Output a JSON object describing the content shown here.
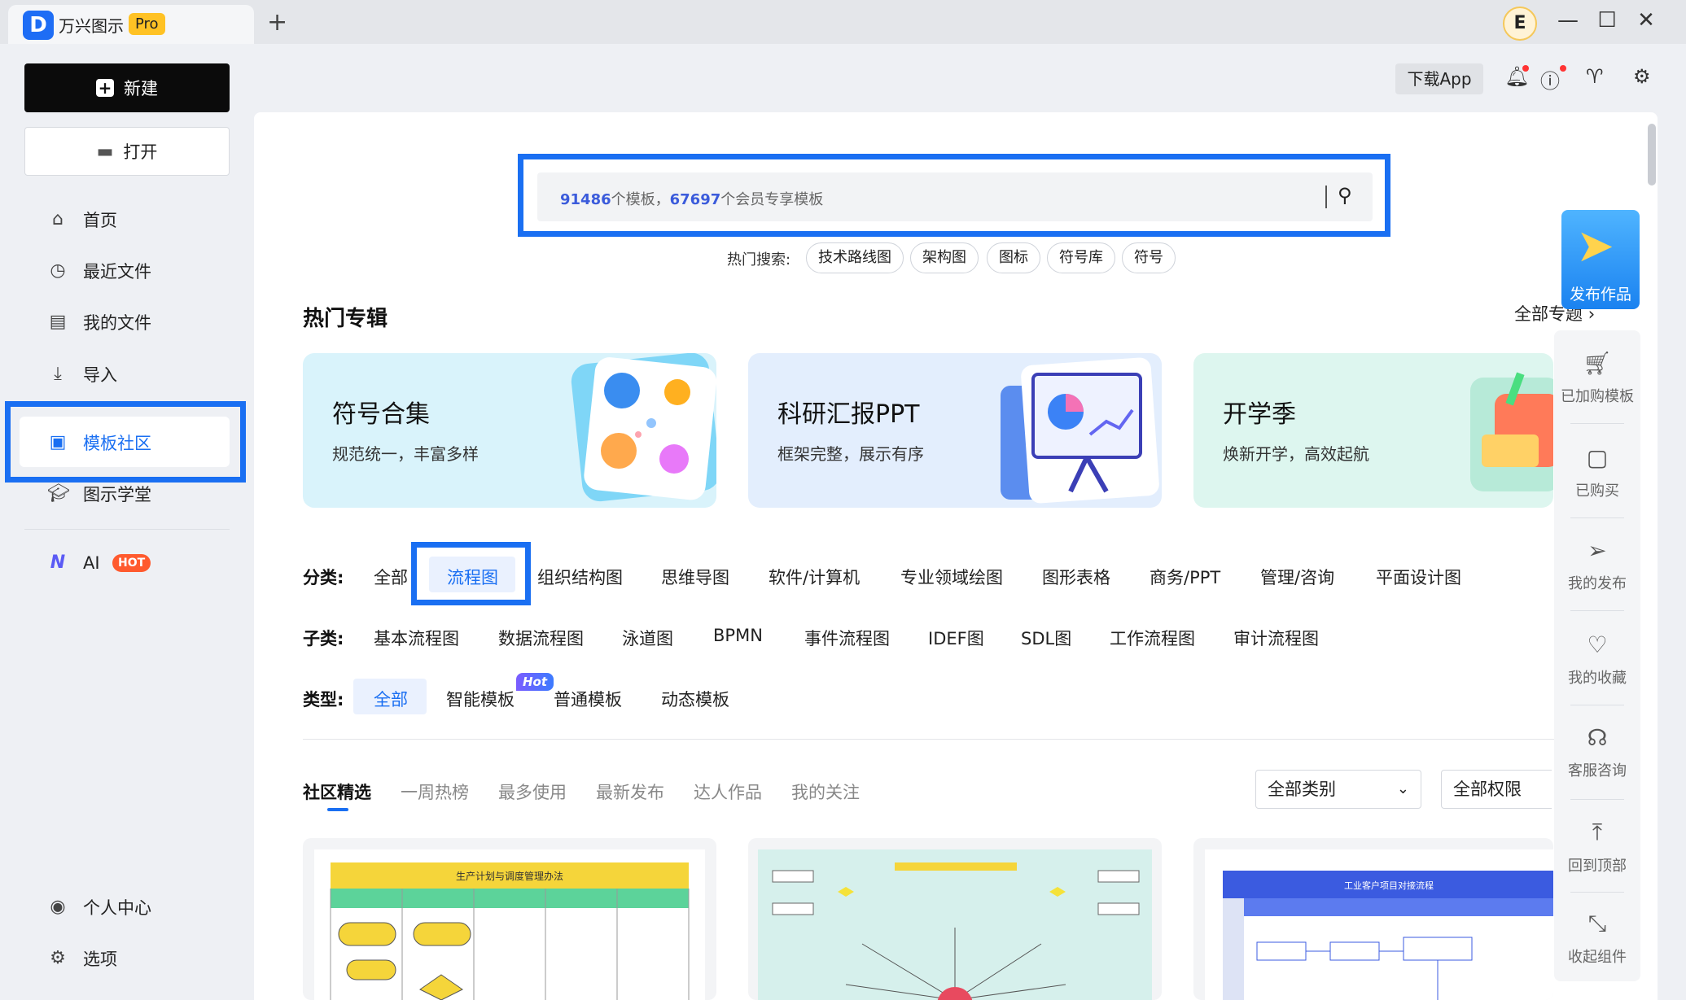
{
  "titlebar": {
    "app_name": "万兴图示",
    "pro_badge": "Pro",
    "new_tab": "+",
    "avatar_letter": "E",
    "minimize": "—",
    "maximize": "☐",
    "close": "✕"
  },
  "sidebar": {
    "new_label": "新建",
    "open_label": "打开",
    "nav": [
      {
        "label": "首页",
        "icon": "home-icon"
      },
      {
        "label": "最近文件",
        "icon": "clock-icon"
      },
      {
        "label": "我的文件",
        "icon": "file-icon"
      },
      {
        "label": "导入",
        "icon": "import-icon"
      },
      {
        "label": "模板社区",
        "icon": "template-community-icon"
      },
      {
        "label": "图示学堂",
        "icon": "graduation-cap-icon"
      },
      {
        "label": "AI",
        "icon": "ai-logo-icon"
      }
    ],
    "ai_badge": "HOT",
    "bottom": [
      {
        "label": "个人中心",
        "icon": "user-icon"
      },
      {
        "label": "选项",
        "icon": "gear-icon"
      }
    ]
  },
  "toolbar": {
    "download_app": "下载App"
  },
  "search": {
    "template_count": "91486",
    "template_suffix": "个模板，",
    "member_count": "67697",
    "member_suffix": "个会员专享模板",
    "hot_label": "热门搜索:",
    "hot_terms": [
      "技术路线图",
      "架构图",
      "图标",
      "符号库",
      "符号"
    ]
  },
  "featured": {
    "title": "热门专辑",
    "all_link": "全部专题",
    "cards": [
      {
        "title": "符号合集",
        "subtitle": "规范统一，丰富多样",
        "bg": "#d9f3fb"
      },
      {
        "title": "科研汇报PPT",
        "subtitle": "框架完整，展示有序",
        "bg": "#e3eefd"
      },
      {
        "title": "开学季",
        "subtitle": "焕新开学，高效起航",
        "bg": "#ddf6ef"
      }
    ]
  },
  "filters": {
    "category_label": "分类:",
    "categories": [
      "全部",
      "流程图",
      "组织结构图",
      "思维导图",
      "软件/计算机",
      "专业领域绘图",
      "图形表格",
      "商务/PPT",
      "管理/咨询",
      "平面设计图"
    ],
    "subcategory_label": "子类:",
    "subcategories": [
      "基本流程图",
      "数据流程图",
      "泳道图",
      "BPMN",
      "事件流程图",
      "IDEF图",
      "SDL图",
      "工作流程图",
      "审计流程图"
    ],
    "type_label": "类型:",
    "types": [
      "全部",
      "智能模板",
      "普通模板",
      "动态模板"
    ],
    "hot_tag": "Hot"
  },
  "feed": {
    "tabs": [
      "社区精选",
      "一周热榜",
      "最多使用",
      "最新发布",
      "达人作品",
      "我的关注"
    ],
    "category_select": "全部类别",
    "permission_select": "全部权限",
    "templates": [
      {
        "title": "生产计划与调度管理办法"
      },
      {
        "title": ""
      },
      {
        "title": "工业客户项目对接流程"
      }
    ]
  },
  "rightpanel": {
    "publish": "发布作品",
    "items": [
      {
        "label": "已加购模板",
        "icon": "cart-icon"
      },
      {
        "label": "已购买",
        "icon": "purchased-icon"
      },
      {
        "label": "我的发布",
        "icon": "send-icon"
      },
      {
        "label": "我的收藏",
        "icon": "heart-icon"
      },
      {
        "label": "客服咨询",
        "icon": "headset-icon"
      },
      {
        "label": "回到顶部",
        "icon": "to-top-icon"
      },
      {
        "label": "收起组件",
        "icon": "collapse-icon"
      }
    ]
  },
  "colors": {
    "accent": "#1a6ff2",
    "highlight_bg": "#eaf1fe"
  }
}
